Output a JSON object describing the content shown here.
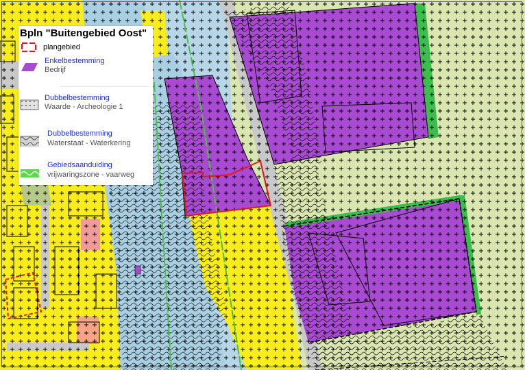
{
  "legend": {
    "title": "Bpln \"Buitengebied Oost\"",
    "items": [
      {
        "label": "plangebied",
        "sublabel": "",
        "symbol": "plangebied-outline-icon",
        "color": "#e0191b"
      },
      {
        "label": "Enkelbestemming",
        "sublabel": "Bedrijf",
        "symbol": "bedrijf-swatch-icon",
        "color": "#a94ad2"
      },
      {
        "label": "Dubbelbestemming",
        "sublabel": "Waarde - Archeologie 1",
        "symbol": "archeologie-swatch-icon",
        "color": "#d6d6d6"
      },
      {
        "label": "Dubbelbestemming",
        "sublabel": "Waterstaat - Waterkering",
        "symbol": "waterkering-swatch-icon",
        "color": "#cfcfcf"
      },
      {
        "label": "Gebiedsaanduiding",
        "sublabel": "vrijwaringszone - vaarweg",
        "symbol": "vrijwaringszone-swatch-icon",
        "color": "#5ed64f"
      }
    ]
  },
  "colors": {
    "bedrijf": "#a94ad2",
    "wonen": "#f8ec1a",
    "water": "#a9cfe3",
    "agrarisch": "#d9e6b0",
    "verkeer": "#c9c9c9",
    "groen": "#3ebd4f",
    "maatschappelijk": "#f09a9a",
    "plangebied": "#e0191b",
    "line": "#000000"
  }
}
